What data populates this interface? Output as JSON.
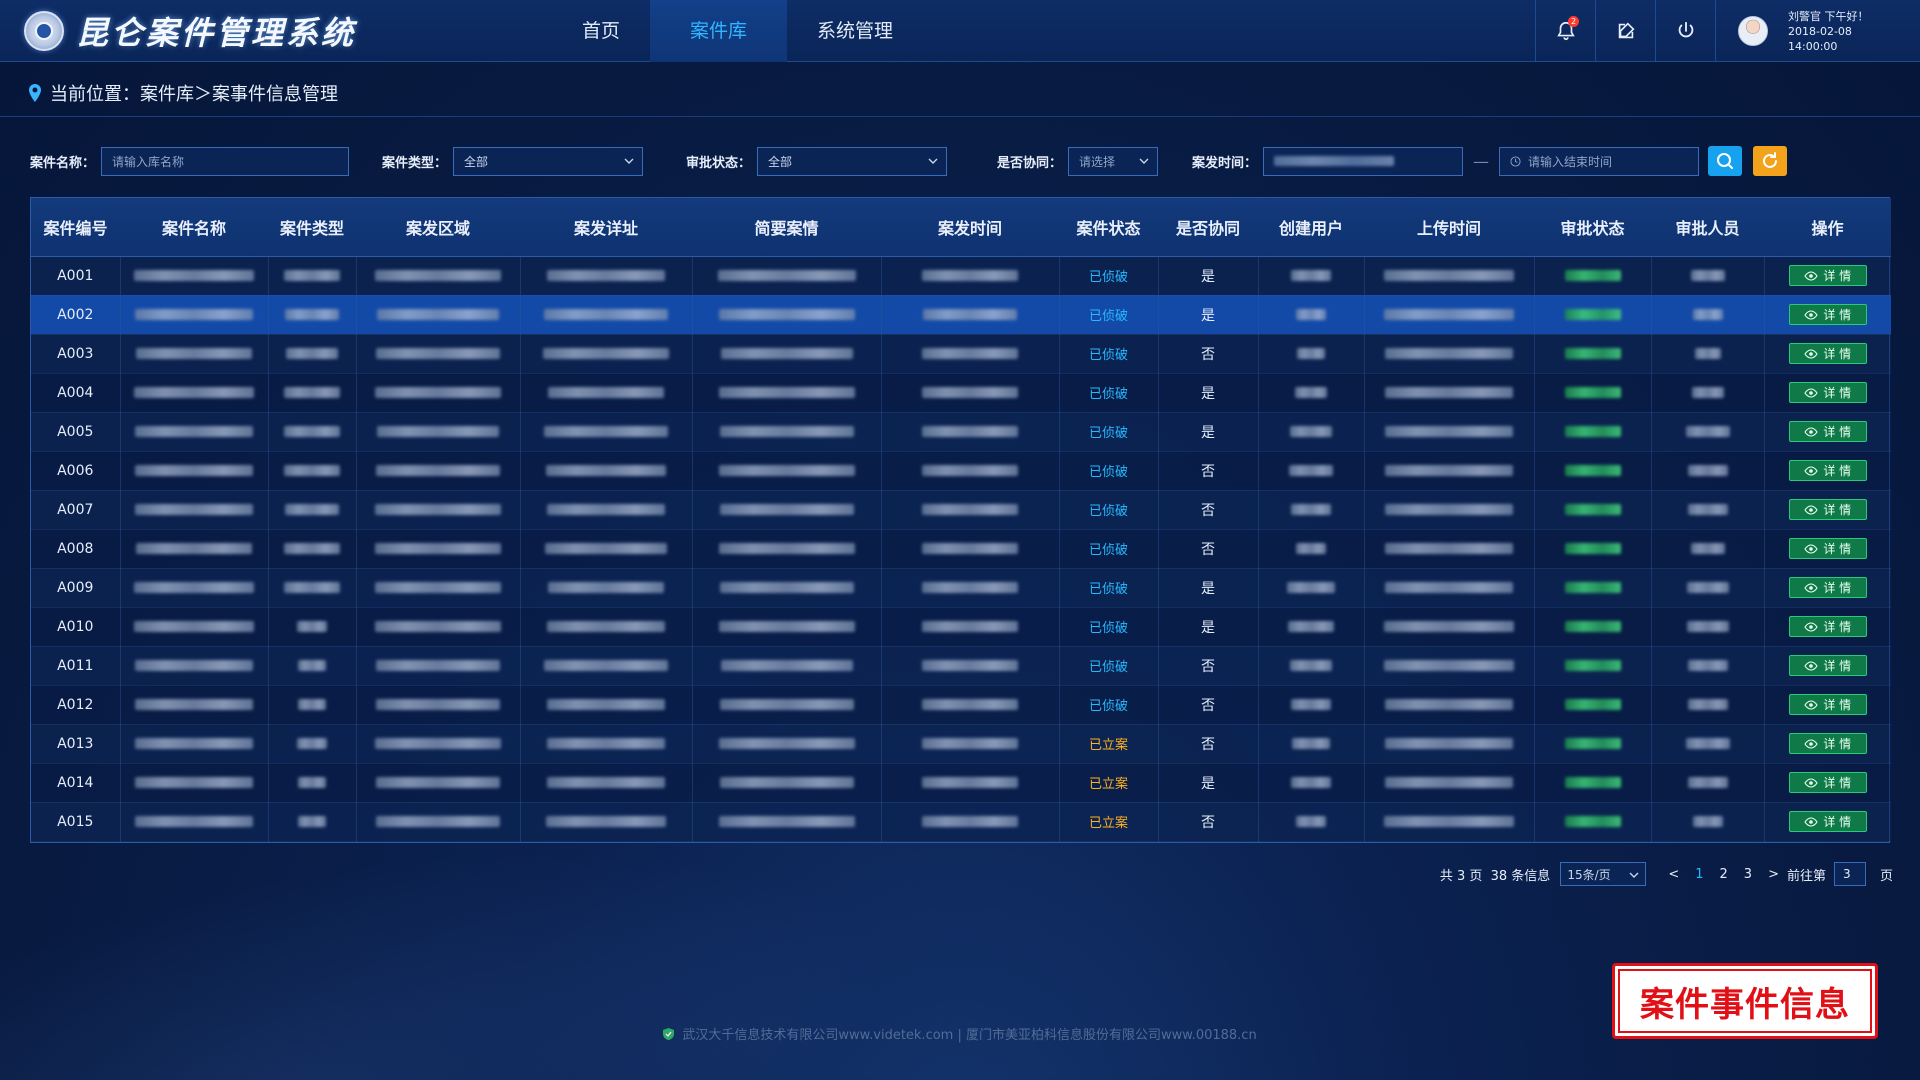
{
  "app": {
    "title": "昆仑案件管理系统"
  },
  "nav": [
    {
      "label": "首页",
      "active": false
    },
    {
      "label": "案件库",
      "active": true
    },
    {
      "label": "系统管理",
      "active": false
    }
  ],
  "header": {
    "notification_count": "2",
    "user_greeting": "刘警官 下午好！",
    "datetime": "2018-02-08 14:00:00"
  },
  "breadcrumb": {
    "text": "当前位置：案件库＞案事件信息管理"
  },
  "filters": {
    "case_name_label": "案件名称：",
    "case_name_placeholder": "请输入库名称",
    "case_type_label": "案件类型：",
    "case_type_value": "全部",
    "approval_status_label": "审批状态：",
    "approval_status_value": "全部",
    "coop_label": "是否协同：",
    "coop_placeholder": "请选择",
    "time_label": "案发时间：",
    "end_time_placeholder": "请输入结束时间",
    "range_separator": "—"
  },
  "table": {
    "columns": [
      "案件编号",
      "案件名称",
      "案件类型",
      "案发区域",
      "案发详址",
      "简要案情",
      "案发时间",
      "案件状态",
      "是否协同",
      "创建用户",
      "上传时间",
      "审批状态",
      "审批人员",
      "操作"
    ],
    "detail_label": "详 情",
    "rows": [
      {
        "id": "A001",
        "status": "已侦破",
        "status_kind": "solved",
        "coop": "是",
        "selected": false
      },
      {
        "id": "A002",
        "status": "已侦破",
        "status_kind": "solved",
        "coop": "是",
        "selected": true
      },
      {
        "id": "A003",
        "status": "已侦破",
        "status_kind": "solved",
        "coop": "否",
        "selected": false
      },
      {
        "id": "A004",
        "status": "已侦破",
        "status_kind": "solved",
        "coop": "是",
        "selected": false
      },
      {
        "id": "A005",
        "status": "已侦破",
        "status_kind": "solved",
        "coop": "是",
        "selected": false
      },
      {
        "id": "A006",
        "status": "已侦破",
        "status_kind": "solved",
        "coop": "否",
        "selected": false
      },
      {
        "id": "A007",
        "status": "已侦破",
        "status_kind": "solved",
        "coop": "否",
        "selected": false
      },
      {
        "id": "A008",
        "status": "已侦破",
        "status_kind": "solved",
        "coop": "否",
        "selected": false
      },
      {
        "id": "A009",
        "status": "已侦破",
        "status_kind": "solved",
        "coop": "是",
        "selected": false
      },
      {
        "id": "A010",
        "status": "已侦破",
        "status_kind": "solved",
        "coop": "是",
        "selected": false
      },
      {
        "id": "A011",
        "status": "已侦破",
        "status_kind": "solved",
        "coop": "否",
        "selected": false
      },
      {
        "id": "A012",
        "status": "已侦破",
        "status_kind": "solved",
        "coop": "否",
        "selected": false
      },
      {
        "id": "A013",
        "status": "已立案",
        "status_kind": "filed",
        "coop": "否",
        "selected": false
      },
      {
        "id": "A014",
        "status": "已立案",
        "status_kind": "filed",
        "coop": "是",
        "selected": false
      },
      {
        "id": "A015",
        "status": "已立案",
        "status_kind": "filed",
        "coop": "否",
        "selected": false
      }
    ]
  },
  "pagination": {
    "summary": "共 3 页  38 条信息",
    "page_size": "15条/页",
    "prev": "<",
    "pages": [
      "1",
      "2",
      "3"
    ],
    "current_page": "1",
    "next": ">",
    "goto_label": "前往第",
    "goto_value": "3",
    "goto_suffix": "页"
  },
  "footer": {
    "text": "武汉大千信息技术有限公司www.videtek.com | 厦门市美亚柏科信息股份有限公司www.00188.cn"
  },
  "stamp": {
    "text": "案件事件信息"
  },
  "colors": {
    "accent": "#27b8ff",
    "solved": "#27b8ff",
    "filed": "#ffb21f",
    "detail": "#0f7a48",
    "stamp": "#e10f16"
  },
  "icons": {
    "bell": "bell-icon",
    "edit": "edit-icon",
    "power": "power-icon",
    "location": "location-pin-icon",
    "search": "search-icon",
    "refresh": "refresh-icon",
    "eye": "eye-icon",
    "clock": "clock-icon",
    "shield": "shield-check-icon"
  }
}
